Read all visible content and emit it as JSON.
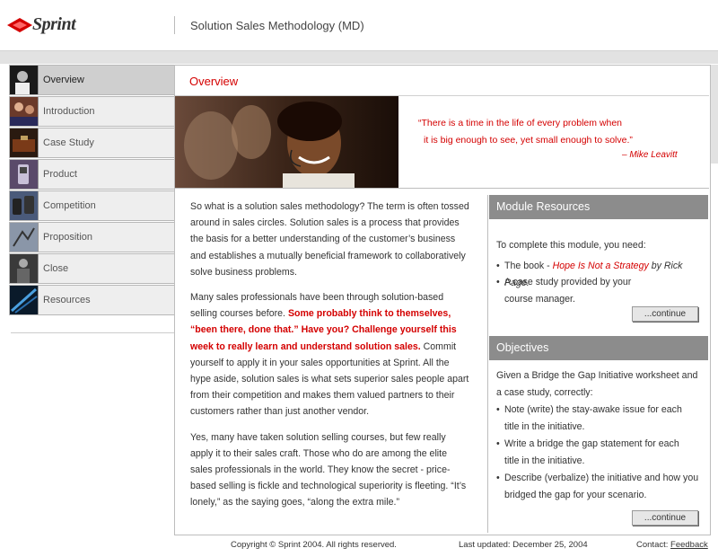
{
  "header": {
    "brand": "Sprint",
    "title": "Solution Sales Methodology (MD)"
  },
  "sidebar": {
    "items": [
      {
        "label": "Overview",
        "active": true
      },
      {
        "label": "Introduction",
        "active": false
      },
      {
        "label": "Case Study",
        "active": false
      },
      {
        "label": "Product",
        "active": false
      },
      {
        "label": "Competition",
        "active": false
      },
      {
        "label": "Proposition",
        "active": false
      },
      {
        "label": "Close",
        "active": false
      },
      {
        "label": "Resources",
        "active": false
      }
    ]
  },
  "main": {
    "title": "Overview",
    "quote_line1": "“There is a time in the life of every problem when",
    "quote_line2": "it is big enough to see, yet small enough to solve.”",
    "quote_author": "–  Mike Leavitt",
    "p1": "So what is a solution sales methodology? The term is often tossed around in sales circles. Solution sales is a process that provides the basis for a better understanding of the customer’s business and establishes a mutually beneficial framework to collaboratively solve business problems.",
    "p2_a": "Many sales professionals have been through solution-based selling courses before. ",
    "p2_red": "Some probably think to themselves, “been there, done that.” Have you? Challenge yourself this week to really learn and understand solution sales.",
    "p2_b": " Commit yourself to apply it in your sales opportunities at Sprint. All the hype aside, solution sales is what sets superior sales people apart from their competition and makes them valued partners to their customers rather than just another vendor.",
    "p3": "Yes, many have taken solution selling courses, but few really apply it to their sales craft. Those who do are among the elite sales professionals in the world. They know the secret - price-based selling is fickle and technological superiority is fleeting. “It’s lonely,” as the saying goes, “along the extra mile.”"
  },
  "resources": {
    "header": "Module Resources",
    "intro": "To complete this module, you need:",
    "b1_pre": "The book - ",
    "b1_title": "Hope Is Not a Strategy",
    "b1_post": " by Rick Page.",
    "b2": "A case study provided by your course manager.",
    "continue": "...continue"
  },
  "objectives": {
    "header": "Objectives",
    "intro": "Given a Bridge the Gap Initiative worksheet and a case study, correctly:",
    "b1": "Note (write) the stay-awake issue for each title in the initiative.",
    "b2": "Write a bridge the gap statement for each title in the initiative.",
    "b3": "Describe (verbalize) the initiative and how you bridged the gap for your scenario.",
    "continue": "...continue"
  },
  "footer": {
    "copyright": "Copyright © Sprint 2004. All rights reserved.",
    "updated": "Last  updated: December 25, 2004",
    "contact": "Contact: ",
    "feedback": "Feedback"
  },
  "colors": {
    "accent": "#d40000",
    "section_header": "#8c8c8c"
  },
  "icons": [
    "sprint-diamond-logo-icon"
  ]
}
